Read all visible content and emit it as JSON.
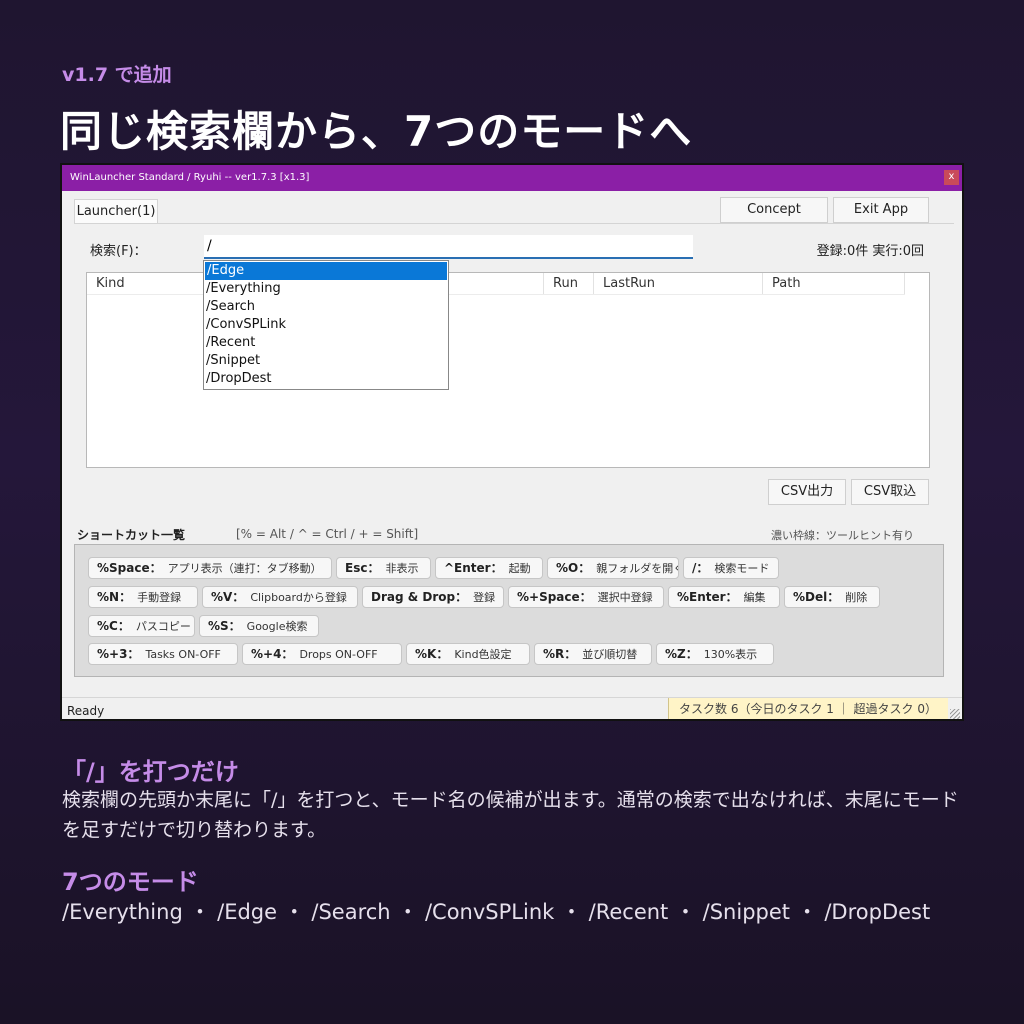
{
  "header": {
    "version_tag": "v1.7 で追加",
    "headline": "同じ検索欄から、7つのモードへ"
  },
  "window": {
    "title": "WinLauncher Standard / Ryuhi -- ver1.7.3 [x1.3]",
    "close_label": "x",
    "buttons": {
      "concept": "Concept",
      "exit": "Exit App"
    },
    "tab_label": "Launcher(1)",
    "search": {
      "label": "検索(F)：",
      "value": "/"
    },
    "stats": "登録:0件 実行:0回",
    "columns": [
      "Kind",
      "Run",
      "LastRun",
      "Path"
    ],
    "dropdown": {
      "items": [
        "/Edge",
        "/Everything",
        "/Search",
        "/ConvSPLink",
        "/Recent",
        "/Snippet",
        "/DropDest"
      ],
      "selected_index": 0
    },
    "csv_buttons": {
      "export": "CSV出力",
      "import": "CSV取込"
    },
    "shortcuts": {
      "title": "ショートカット一覧",
      "hint": "[% = Alt / ^ = Ctrl / + = Shift]",
      "note": "濃い枠線：ツールヒント有り",
      "items": [
        {
          "key": "%Space：",
          "desc": "アプリ表示（連打：タブ移動）"
        },
        {
          "key": "Esc：",
          "desc": "非表示"
        },
        {
          "key": "^Enter：",
          "desc": "起動"
        },
        {
          "key": "%O：",
          "desc": "親フォルダを開く"
        },
        {
          "key": "/：",
          "desc": "検索モード"
        },
        {
          "key": "%N：",
          "desc": "手動登録"
        },
        {
          "key": "%V：",
          "desc": "Clipboardから登録"
        },
        {
          "key": "Drag & Drop：",
          "desc": "登録"
        },
        {
          "key": "%+Space：",
          "desc": "選択中登録"
        },
        {
          "key": "%Enter：",
          "desc": "編集"
        },
        {
          "key": "%Del：",
          "desc": "削除"
        },
        {
          "key": "%C：",
          "desc": "パスコピー"
        },
        {
          "key": "%S：",
          "desc": "Google検索"
        },
        {
          "key": "%+3：",
          "desc": "Tasks ON-OFF"
        },
        {
          "key": "%+4：",
          "desc": "Drops ON-OFF"
        },
        {
          "key": "%K：",
          "desc": "Kind色設定"
        },
        {
          "key": "%R：",
          "desc": "並び順切替"
        },
        {
          "key": "%Z：",
          "desc": "130%表示"
        }
      ]
    },
    "status": {
      "ready": "Ready",
      "tasks": "タスク数 6（今日のタスク 1 ｜ 超過タスク 0）"
    }
  },
  "section1": {
    "heading": "「/」を打つだけ",
    "body": "検索欄の先頭か末尾に「/」を打つと、モード名の候補が出ます。通常の検索で出なければ、末尾にモードを足すだけで切り替わります。"
  },
  "section2": {
    "heading": "7つのモード",
    "modes": "/Everything ・ /Edge ・ /Search ・ /ConvSPLink ・ /Recent ・ /Snippet ・ /DropDest"
  },
  "colors": {
    "accent": "#c58ce8",
    "titlebar": "#8b1fa6",
    "selection": "#0a78d7",
    "status_tasks": "#fff4c7"
  }
}
